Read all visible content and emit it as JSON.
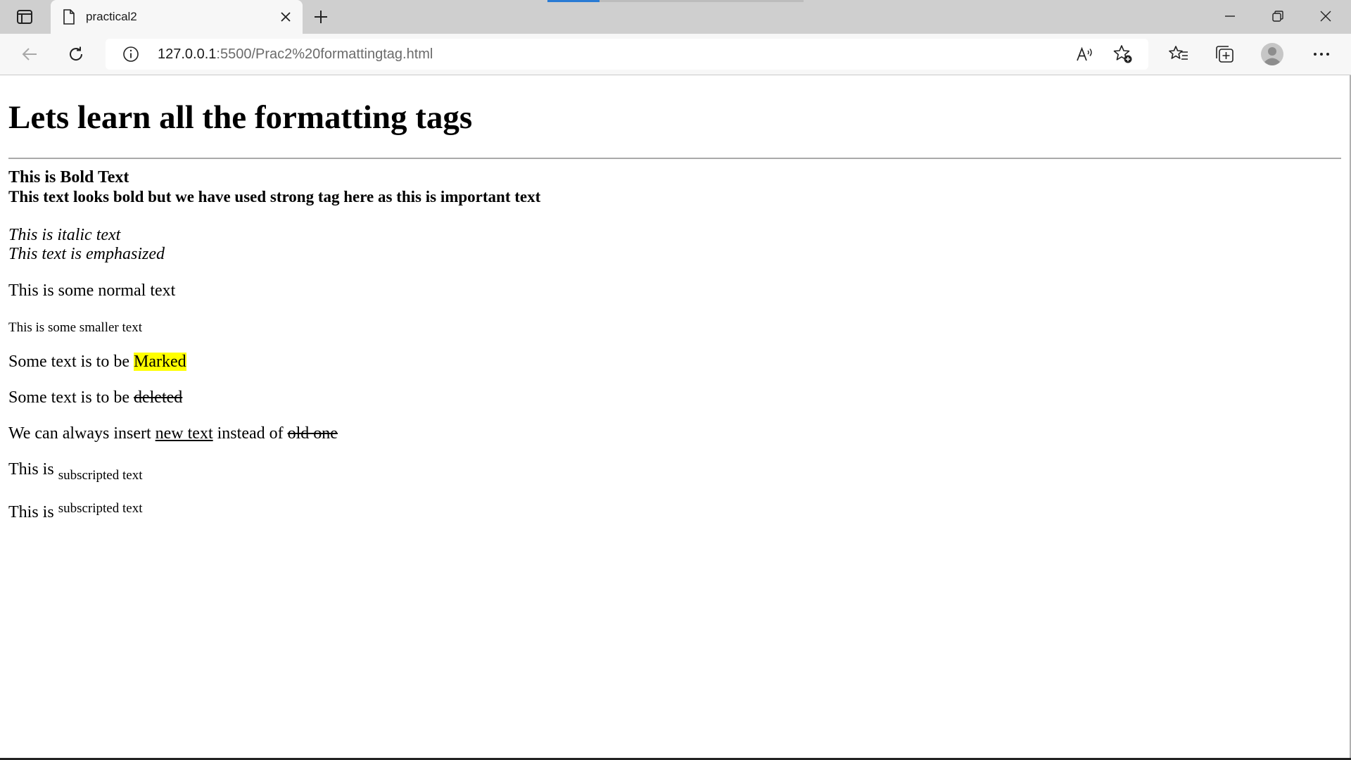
{
  "browser": {
    "tab": {
      "title": "practical2"
    },
    "address_bar": {
      "url_host": "127.0.0.1",
      "url_path": ":5500/Prac2%20formattingtag.html"
    }
  },
  "page": {
    "heading": "Lets learn all the formatting tags",
    "bold_text": "This is Bold Text",
    "strong_text": "This text looks bold but we have used strong tag here as this is important text",
    "italic_text": "This is italic text",
    "emphasized_text": "This text is emphasized",
    "normal_text": "This is some normal text",
    "small_text": "This is some smaller text",
    "marked_line": {
      "prefix": "Some text is to be ",
      "marked": "Marked"
    },
    "deleted_line": {
      "prefix": "Some text is to be ",
      "deleted": "deleted"
    },
    "insert_line": {
      "prefix": "We can always insert ",
      "inserted": "new text",
      "middle": " instead of ",
      "deleted": "old one"
    },
    "sub_line": {
      "prefix": "This is ",
      "sub": "subscripted text"
    },
    "sup_line": {
      "prefix": "This is ",
      "sup": "subscripted text"
    },
    "colors": {
      "mark": "#ffff00",
      "loading_bar": "#2a7bd4"
    }
  }
}
